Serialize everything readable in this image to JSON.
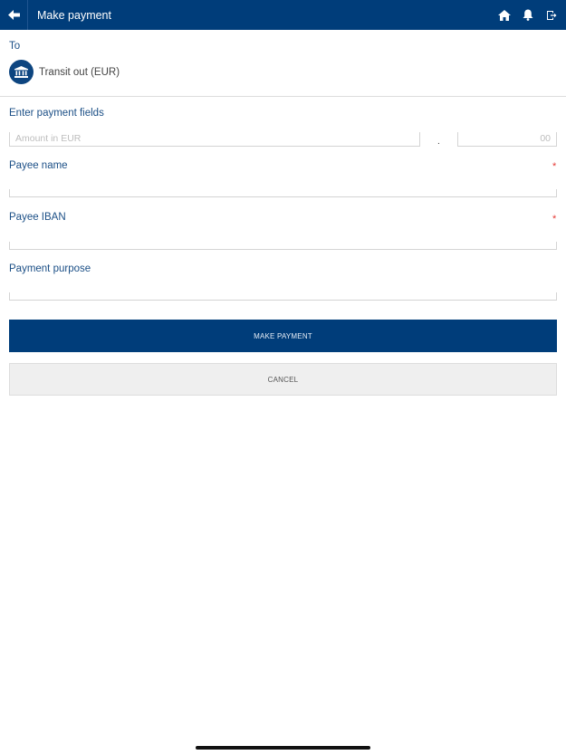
{
  "header": {
    "title": "Make payment",
    "icons": [
      "back-arrow-icon",
      "home-icon",
      "bell-icon",
      "logout-icon"
    ]
  },
  "to": {
    "label": "To",
    "recipient": "Transit out (EUR)",
    "icon": "bank-icon"
  },
  "payment_fields": {
    "label": "Enter payment fields",
    "amount_placeholder": "Amount in EUR",
    "cents_placeholder": "00",
    "decimal_separator": "."
  },
  "payee_name": {
    "label": "Payee name",
    "required_marker": "*",
    "value": ""
  },
  "payee_iban": {
    "label": "Payee IBAN",
    "required_marker": "*",
    "value": ""
  },
  "payment_purpose": {
    "label": "Payment purpose",
    "value": ""
  },
  "buttons": {
    "make_payment": "MAKE PAYMENT",
    "cancel": "CANCEL"
  },
  "colors": {
    "brand": "#003d7a",
    "label": "#1b4f86",
    "required": "#e53935",
    "secondary_button": "#efefef"
  }
}
